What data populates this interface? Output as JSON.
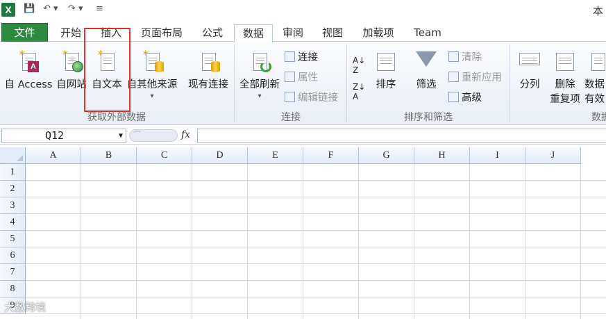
{
  "window": {
    "title_fragment": "本"
  },
  "tabs": [
    {
      "label": "文件",
      "key": "file"
    },
    {
      "label": "开始",
      "key": "home"
    },
    {
      "label": "插入",
      "key": "insert"
    },
    {
      "label": "页面布局",
      "key": "layout"
    },
    {
      "label": "公式",
      "key": "formulas"
    },
    {
      "label": "数据",
      "key": "data",
      "active": true
    },
    {
      "label": "审阅",
      "key": "review"
    },
    {
      "label": "视图",
      "key": "view"
    },
    {
      "label": "加载项",
      "key": "addins"
    },
    {
      "label": "Team",
      "key": "team"
    }
  ],
  "ribbon": {
    "get_external": {
      "from_access": "自 Access",
      "from_web": "自网站",
      "from_text": "自文本",
      "from_other": "自其他来源",
      "existing": "现有连接",
      "group_label": "获取外部数据"
    },
    "connections": {
      "refresh_all": "全部刷新",
      "connections": "连接",
      "properties": "属性",
      "edit_links": "编辑链接",
      "group_label": "连接"
    },
    "sort_filter": {
      "sort": "排序",
      "filter": "筛选",
      "clear": "清除",
      "reapply": "重新应用",
      "advanced": "高级",
      "group_label": "排序和筛选"
    },
    "data_tools": {
      "text_to_columns": "分列",
      "remove_dup_line1": "删除",
      "remove_dup_line2": "重复项",
      "validation_line1": "数据",
      "validation_line2": "有效",
      "group_label": "数据"
    },
    "icons": {
      "highlight_color": "#d9302c"
    }
  },
  "formula_bar": {
    "name_box": "Q12",
    "fx": "fx",
    "formula": ""
  },
  "grid": {
    "columns": [
      "A",
      "B",
      "C",
      "D",
      "E",
      "F",
      "G",
      "H",
      "I",
      "J"
    ],
    "rows": [
      "1",
      "2",
      "3",
      "4",
      "5",
      "6",
      "7",
      "8",
      "9"
    ]
  },
  "watermark": "大数跨境"
}
